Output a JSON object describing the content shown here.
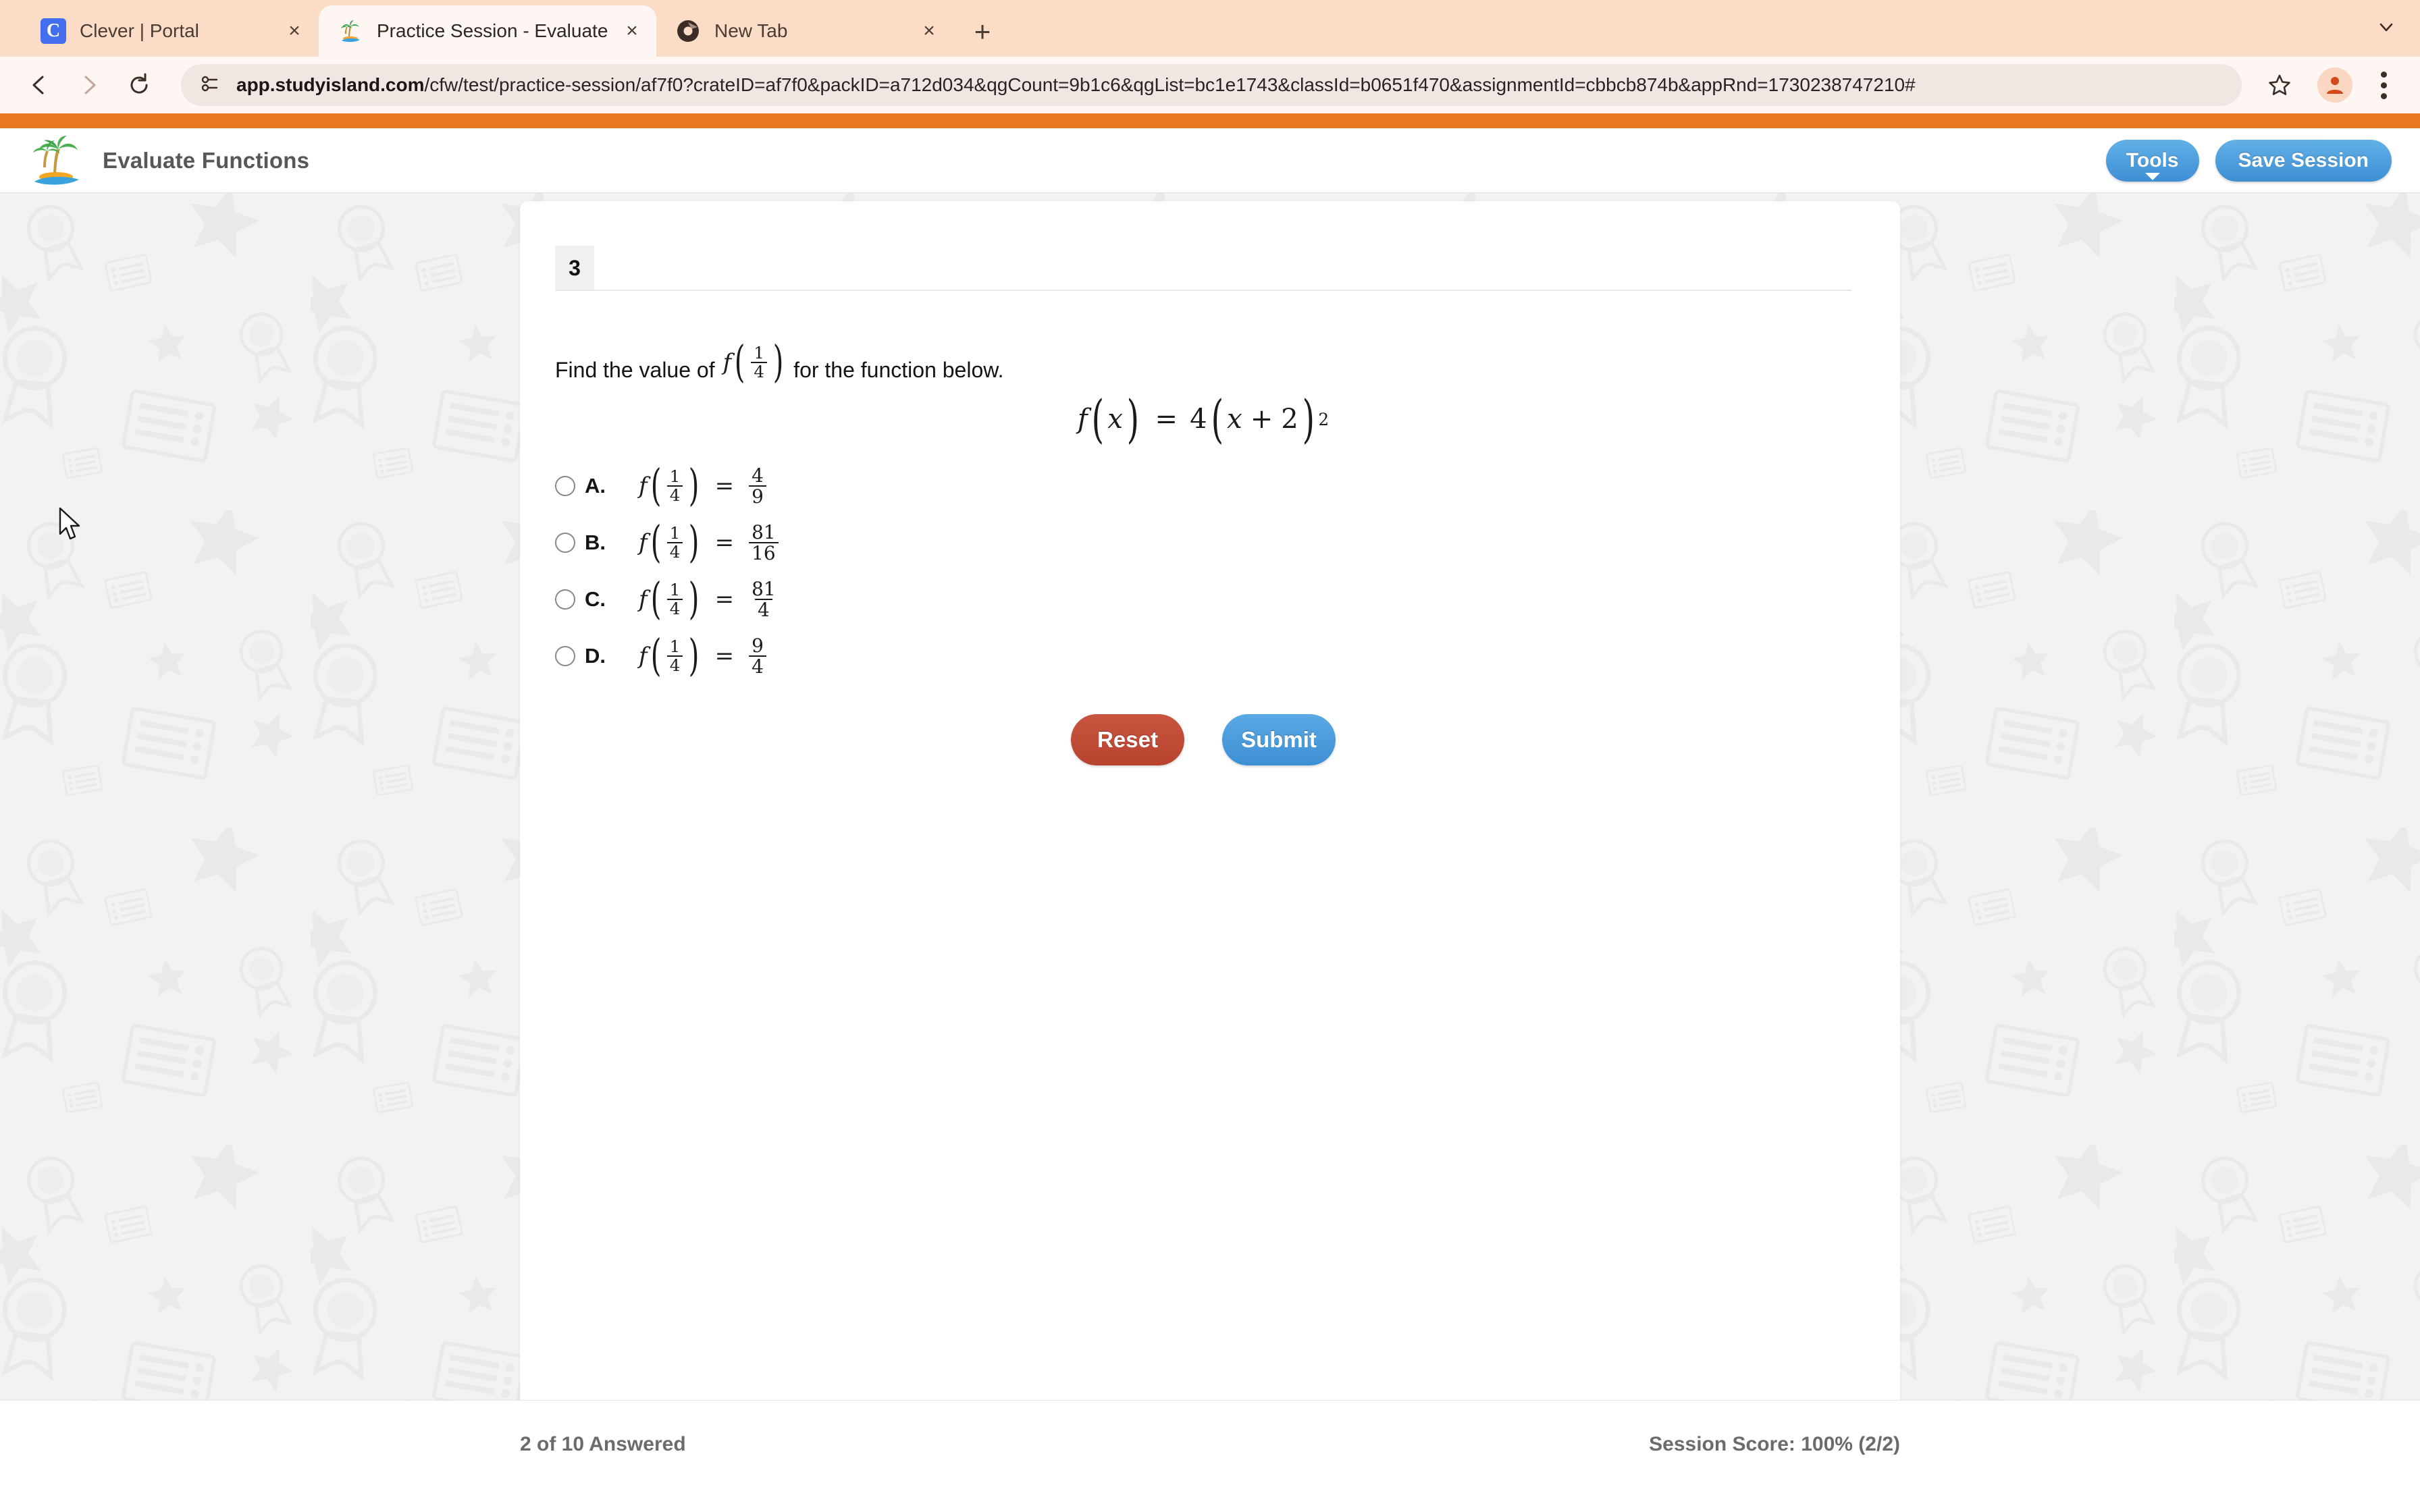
{
  "browser": {
    "tabs": [
      {
        "title": "Clever | Portal",
        "favicon": "clever-icon",
        "active": false,
        "close_label": "×"
      },
      {
        "title": "Practice Session - Evaluate Fu",
        "favicon": "study-island-palm-icon",
        "active": true,
        "close_label": "×"
      },
      {
        "title": "New Tab",
        "favicon": "chrome-icon",
        "active": false,
        "close_label": "×"
      }
    ],
    "new_tab_label": "+",
    "toolbar": {
      "back_icon": "back-arrow-icon",
      "forward_icon": "forward-arrow-icon",
      "reload_icon": "reload-icon",
      "site_info_icon": "site-settings-icon",
      "bookmark_icon": "star-icon",
      "profile_icon": "profile-avatar-icon",
      "menu_icon": "three-dot-menu-icon",
      "url_host": "app.studyisland.com",
      "url_path": "/cfw/test/practice-session/af7f0?crateID=af7f0&packID=a712d034&qgCount=9b1c6&qgList=bc1e1743&classId=b0651f470&assignmentId=cbbcb874b&appRnd=1730238747210#"
    }
  },
  "app": {
    "title": "Evaluate Functions",
    "logo_icon": "palm-tree-island-logo",
    "tools_button": "Tools",
    "save_session_button": "Save Session",
    "accent_orange": "#e87722",
    "accent_blue": "#3d8fd4",
    "accent_red": "#b8432f"
  },
  "question": {
    "number": "3",
    "prompt_before": "Find the value of",
    "prompt_fn_name": "f",
    "prompt_arg_num": "1",
    "prompt_arg_den": "4",
    "prompt_after": "for the function below.",
    "function_lhs_name": "f",
    "function_lhs_var": "x",
    "function_equals": "=",
    "function_coefficient": "4",
    "function_inner_var": "x",
    "function_plus": "+",
    "function_constant": "2",
    "function_exponent": "2",
    "choices": [
      {
        "letter": "A.",
        "fn": "f",
        "arg_num": "1",
        "arg_den": "4",
        "equals": "=",
        "value_num": "4",
        "value_den": "9",
        "selected": false
      },
      {
        "letter": "B.",
        "fn": "f",
        "arg_num": "1",
        "arg_den": "4",
        "equals": "=",
        "value_num": "81",
        "value_den": "16",
        "selected": false
      },
      {
        "letter": "C.",
        "fn": "f",
        "arg_num": "1",
        "arg_den": "4",
        "equals": "=",
        "value_num": "81",
        "value_den": "4",
        "selected": false
      },
      {
        "letter": "D.",
        "fn": "f",
        "arg_num": "1",
        "arg_den": "4",
        "equals": "=",
        "value_num": "9",
        "value_den": "4",
        "selected": false
      }
    ],
    "reset_button": "Reset",
    "submit_button": "Submit"
  },
  "footer": {
    "progress": "2 of 10 Answered",
    "score": "Session Score: 100% (2/2)"
  }
}
